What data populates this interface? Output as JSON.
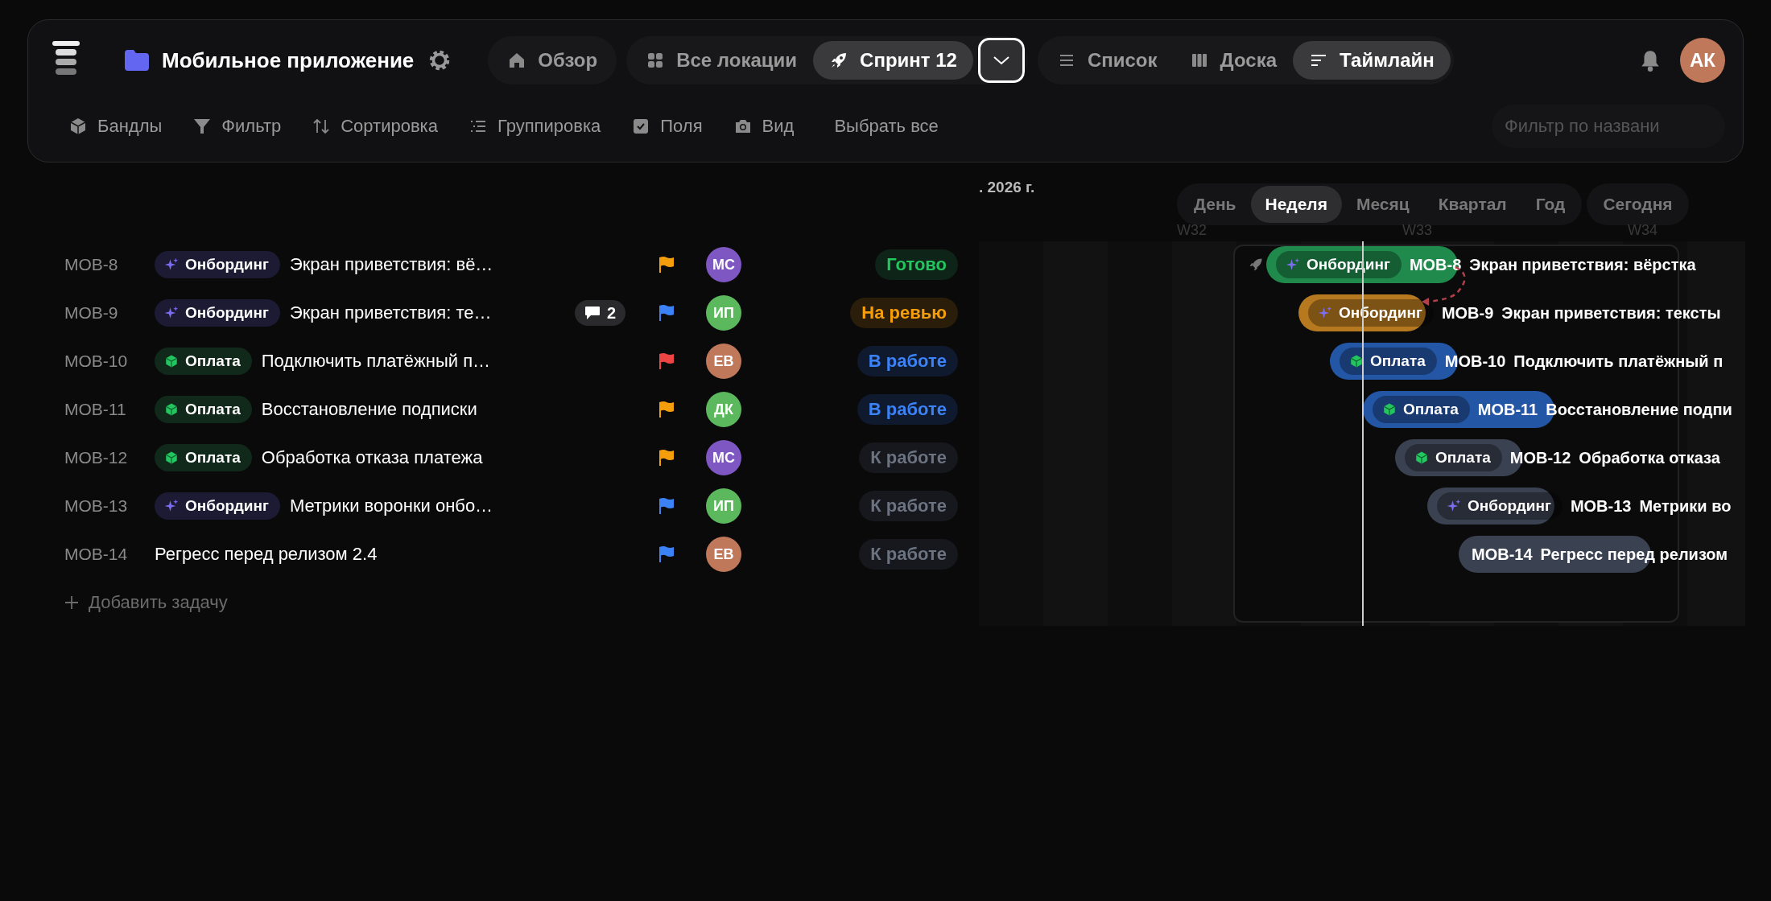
{
  "header": {
    "project_title": "Мобильное приложение",
    "nav": [
      {
        "label": "Обзор",
        "kind": "home",
        "selected": false
      }
    ],
    "locations": [
      {
        "label": "Все локации",
        "kind": "grid",
        "selected": false
      },
      {
        "label": "Спринт 12",
        "kind": "rocket",
        "selected": true
      }
    ],
    "views": [
      {
        "label": "Список",
        "kind": "list",
        "selected": false
      },
      {
        "label": "Доска",
        "kind": "board",
        "selected": false
      },
      {
        "label": "Таймлайн",
        "kind": "timeline",
        "selected": true
      }
    ],
    "avatar": {
      "initials": "АК",
      "color": "#c0785a"
    }
  },
  "toolbar": {
    "items": [
      {
        "label": "Бандлы",
        "kind": "bundle"
      },
      {
        "label": "Фильтр",
        "kind": "filter"
      },
      {
        "label": "Сортировка",
        "kind": "sort"
      },
      {
        "label": "Группировка",
        "kind": "group"
      },
      {
        "label": "Поля",
        "kind": "fields"
      },
      {
        "label": "Вид",
        "kind": "view"
      }
    ],
    "select_all": "Выбрать все",
    "filter_placeholder": "Фильтр по названи"
  },
  "tasks": [
    {
      "id": "MOB-8",
      "tag": {
        "label": "Онбординг",
        "kind": "onboarding"
      },
      "title": "Экран приветствия: вё…",
      "flag": {
        "color": "#f59e0b"
      },
      "assignee": {
        "initials": "МС",
        "color": "#7e57c2"
      },
      "status": {
        "label": "Готово",
        "kind": "done"
      }
    },
    {
      "id": "MOB-9",
      "tag": {
        "label": "Онбординг",
        "kind": "onboarding"
      },
      "title": "Экран приветствия: те…",
      "comments": "2",
      "flag": {
        "color": "#3b82f6"
      },
      "assignee": {
        "initials": "ИП",
        "color": "#5cb85c"
      },
      "status": {
        "label": "На ревью",
        "kind": "review"
      }
    },
    {
      "id": "MOB-10",
      "tag": {
        "label": "Оплата",
        "kind": "payment"
      },
      "title": "Подключить платёжный п…",
      "flag": {
        "color": "#ef4444"
      },
      "assignee": {
        "initials": "ЕВ",
        "color": "#c0785a"
      },
      "status": {
        "label": "В работе",
        "kind": "progress"
      }
    },
    {
      "id": "MOB-11",
      "tag": {
        "label": "Оплата",
        "kind": "payment"
      },
      "title": "Восстановление подписки",
      "flag": {
        "color": "#f59e0b"
      },
      "assignee": {
        "initials": "ДК",
        "color": "#5cb85c"
      },
      "status": {
        "label": "В работе",
        "kind": "progress"
      }
    },
    {
      "id": "MOB-12",
      "tag": {
        "label": "Оплата",
        "kind": "payment"
      },
      "title": "Обработка отказа платежа",
      "flag": {
        "color": "#f59e0b"
      },
      "assignee": {
        "initials": "МС",
        "color": "#7e57c2"
      },
      "status": {
        "label": "К работе",
        "kind": "todo"
      }
    },
    {
      "id": "MOB-13",
      "tag": {
        "label": "Онбординг",
        "kind": "onboarding"
      },
      "title": "Метрики воронки онбо…",
      "flag": {
        "color": "#3b82f6"
      },
      "assignee": {
        "initials": "ИП",
        "color": "#5cb85c"
      },
      "status": {
        "label": "К работе",
        "kind": "todo"
      }
    },
    {
      "id": "MOB-14",
      "title": "Регресс перед релизом 2.4",
      "flag": {
        "color": "#3b82f6"
      },
      "assignee": {
        "initials": "ЕВ",
        "color": "#c0785a"
      },
      "status": {
        "label": "К работе",
        "kind": "todo"
      }
    }
  ],
  "add_task": "Добавить задачу",
  "timeline": {
    "date_label": ". 2026 г.",
    "scales": [
      {
        "label": "День",
        "selected": false
      },
      {
        "label": "Неделя",
        "selected": true
      },
      {
        "label": "Месяц",
        "selected": false
      },
      {
        "label": "Квартал",
        "selected": false
      },
      {
        "label": "Год",
        "selected": false
      }
    ],
    "today_button": "Сегодня",
    "weeks": [
      "W32",
      "W33",
      "W34"
    ],
    "bars": [
      {
        "id": "MOB-8",
        "tag": {
          "label": "Онбординг",
          "kind": "onboarding"
        },
        "title": "Экран приветствия: вёрстка",
        "kind": "done"
      },
      {
        "id": "MOB-9",
        "tag": {
          "label": "Онбординг",
          "kind": "onboarding"
        },
        "title": "Экран приветствия: тексты",
        "kind": "review"
      },
      {
        "id": "MOB-10",
        "tag": {
          "label": "Оплата",
          "kind": "payment"
        },
        "title": "Подключить платёжный п",
        "kind": "progress"
      },
      {
        "id": "MOB-11",
        "tag": {
          "label": "Оплата",
          "kind": "payment"
        },
        "title": "Восстановление подпи",
        "kind": "progress"
      },
      {
        "id": "MOB-12",
        "tag": {
          "label": "Оплата",
          "kind": "payment"
        },
        "title": "Обработка отказа",
        "kind": "todo"
      },
      {
        "id": "MOB-13",
        "tag": {
          "label": "Онбординг",
          "kind": "onboarding"
        },
        "title": "Метрики во",
        "kind": "todo"
      },
      {
        "id": "MOB-14",
        "title": "Регресс перед релизом",
        "kind": "todo"
      }
    ]
  }
}
